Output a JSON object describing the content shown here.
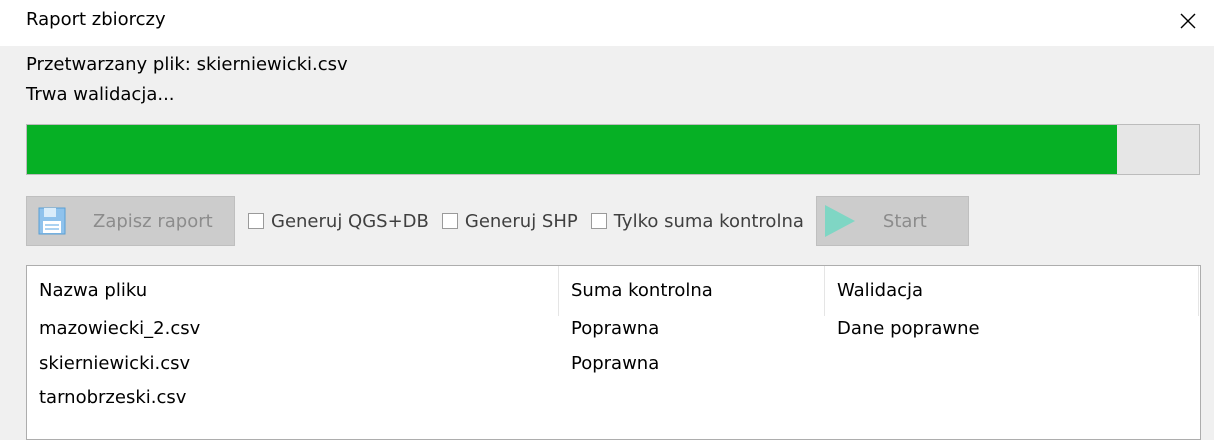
{
  "window": {
    "title": "Raport zbiorczy",
    "close_icon": "close-icon"
  },
  "status": {
    "file_line": "Przetwarzany plik: skierniewicki.csv",
    "state_line": "Trwa walidacja..."
  },
  "progress": {
    "percent": 93,
    "fill_color": "#06b025"
  },
  "toolbar": {
    "save": {
      "label": "Zapisz raport",
      "icon": "floppy-disk-icon",
      "enabled": false
    },
    "checkboxes": [
      {
        "label": "Generuj QGS+DB",
        "checked": false
      },
      {
        "label": "Generuj SHP",
        "checked": false
      },
      {
        "label": "Tylko suma kontrolna",
        "checked": false
      }
    ],
    "start": {
      "label": "Start",
      "icon": "play-icon",
      "enabled": false
    }
  },
  "table": {
    "columns": [
      "Nazwa pliku",
      "Suma kontrolna",
      "Walidacja"
    ],
    "rows": [
      [
        "mazowiecki_2.csv",
        "Poprawna",
        "Dane poprawne"
      ],
      [
        "skierniewicki.csv",
        "Poprawna",
        ""
      ],
      [
        "tarnobrzeski.csv",
        "",
        ""
      ]
    ]
  }
}
